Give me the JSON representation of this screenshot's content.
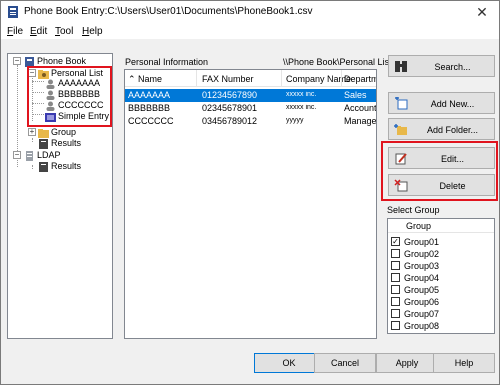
{
  "window": {
    "title": "Phone Book Entry:C:\\Users\\User01\\Documents\\PhoneBook1.csv",
    "close_glyph": "✕"
  },
  "menu": [
    {
      "label": "File",
      "accel": "F",
      "rest": "ile"
    },
    {
      "label": "Edit",
      "accel": "E",
      "rest": "dit"
    },
    {
      "label": "Tool",
      "accel": "T",
      "rest": "ool"
    },
    {
      "label": "Help",
      "accel": "H",
      "rest": "elp"
    }
  ],
  "tree": {
    "root": "Phone Book",
    "personal_list": "Personal List",
    "entries": [
      "AAAAAAA",
      "BBBBBBB",
      "CCCCCCC"
    ],
    "simple_entry": "Simple Entry",
    "group": "Group",
    "group_results": "Results",
    "ldap": "LDAP",
    "ldap_results": "Results",
    "expander_minus": "−",
    "expander_plus": "+"
  },
  "personal_info": {
    "label": "Personal Information",
    "path": "\\\\Phone Book\\Personal List",
    "columns": [
      "Name",
      "FAX Number",
      "Company Name",
      "Departmen"
    ],
    "rows": [
      {
        "name": "AAAAAAA",
        "fax": "01234567890",
        "company": "xxxxx inc.",
        "dept": "Sales"
      },
      {
        "name": "BBBBBBB",
        "fax": "02345678901",
        "company": "xxxxx inc.",
        "dept": "Accounting"
      },
      {
        "name": "CCCCCCC",
        "fax": "03456789012",
        "company": "yyyyy",
        "dept": "Manageme"
      }
    ],
    "selected_row": 0
  },
  "buttons": {
    "search": "Search...",
    "add_new": "Add New...",
    "add_folder": "Add Folder...",
    "edit": "Edit...",
    "delete": "Delete"
  },
  "select_group": {
    "label": "Select Group",
    "header": "Group",
    "groups": [
      {
        "name": "Group01",
        "checked": true
      },
      {
        "name": "Group02",
        "checked": false
      },
      {
        "name": "Group03",
        "checked": false
      },
      {
        "name": "Group04",
        "checked": false
      },
      {
        "name": "Group05",
        "checked": false
      },
      {
        "name": "Group06",
        "checked": false
      },
      {
        "name": "Group07",
        "checked": false
      },
      {
        "name": "Group08",
        "checked": false
      }
    ],
    "check_glyph": "✓"
  },
  "footer": {
    "ok": "OK",
    "cancel": "Cancel",
    "apply": "Apply",
    "help": "Help"
  },
  "colors": {
    "selection": "#0078d7",
    "highlight_box": "#e0141e"
  }
}
